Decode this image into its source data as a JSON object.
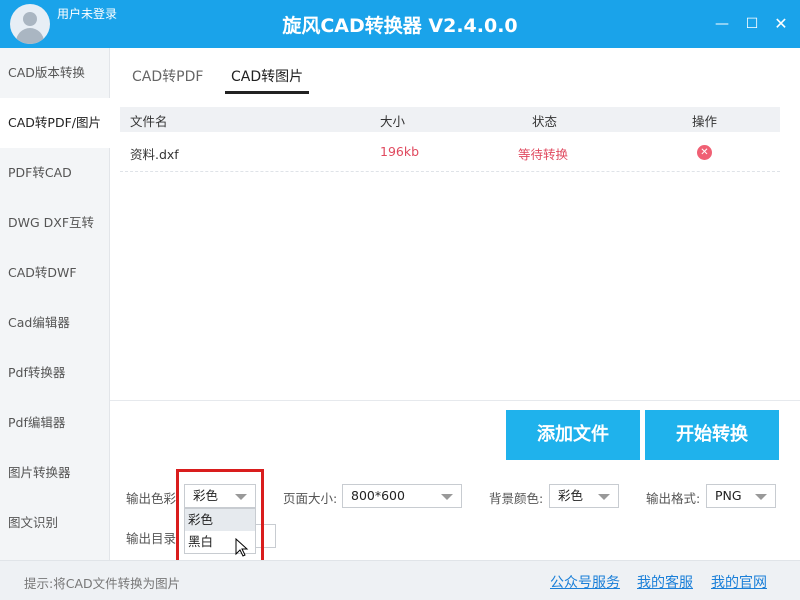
{
  "header": {
    "user_name": "用户未登录",
    "title": "旋风CAD转换器 V2.4.0.0",
    "minimize_icon": "minimize-icon",
    "maximize_icon": "maximize-icon",
    "close_icon": "close-icon"
  },
  "sidebar": {
    "items": [
      {
        "label": "CAD版本转换"
      },
      {
        "label": "CAD转PDF/图片"
      },
      {
        "label": "PDF转CAD"
      },
      {
        "label": "DWG DXF互转"
      },
      {
        "label": "CAD转DWF"
      },
      {
        "label": "Cad编辑器"
      },
      {
        "label": "Pdf转换器"
      },
      {
        "label": "Pdf编辑器"
      },
      {
        "label": "图片转换器"
      },
      {
        "label": "图文识别"
      }
    ],
    "active_index": 1
  },
  "tabs": [
    {
      "label": "CAD转PDF"
    },
    {
      "label": "CAD转图片"
    }
  ],
  "table": {
    "headers": [
      "文件名",
      "大小",
      "状态",
      "操作"
    ],
    "rows": [
      {
        "name": "资料.dxf",
        "size": "196kb",
        "status": "等待转换",
        "action_icon": "delete-icon"
      }
    ]
  },
  "actions": {
    "add_file": "添加文件",
    "start_convert": "开始转换"
  },
  "options": {
    "output_color_label": "输出色彩:",
    "output_color_value": "彩色",
    "page_size_label": "页面大小:",
    "page_size_value": "800*600",
    "bg_color_label": "背景颜色:",
    "bg_color_value": "彩色",
    "output_format_label": "输出格式:",
    "output_format_value": "PNG",
    "output_dir_label": "输出目录",
    "color_options": [
      "彩色",
      "黑白"
    ]
  },
  "status": {
    "hint": "提示:将CAD文件转换为图片",
    "links": [
      "公众号服务",
      "我的客服",
      "我的官网"
    ]
  },
  "colors": {
    "accent": "#1aa3ea",
    "button": "#1fb2ec",
    "status_red": "#e04a5f"
  }
}
